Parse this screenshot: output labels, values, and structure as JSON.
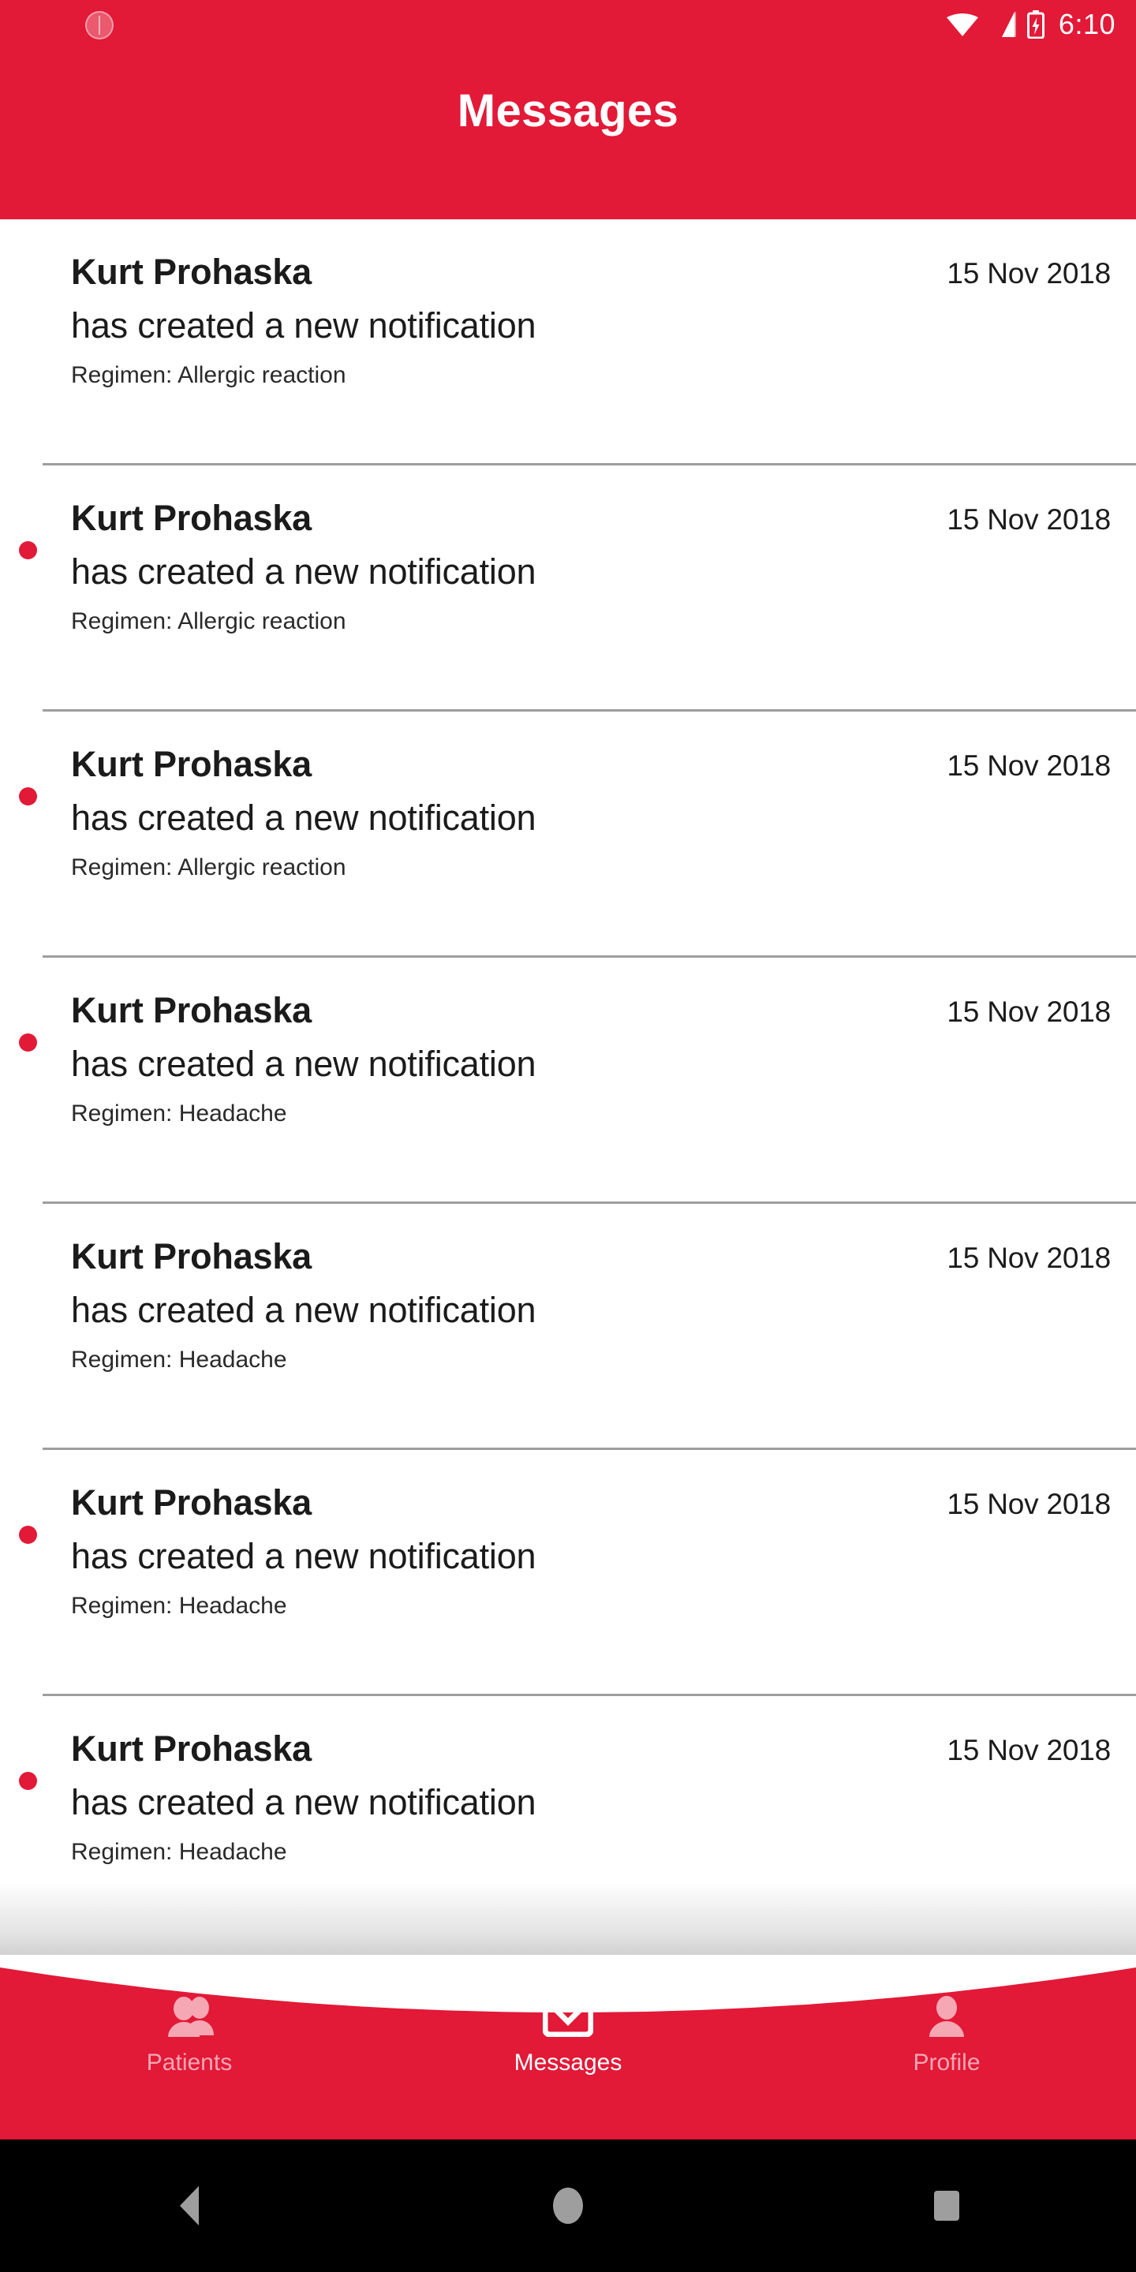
{
  "status_bar": {
    "time": "6:10",
    "left_icon": "sync-circle-icon",
    "right_icons": [
      "wifi-icon",
      "cellular-signal-icon",
      "battery-charging-icon"
    ]
  },
  "header": {
    "title": "Messages",
    "background_color": "#E21937",
    "text_color": "#FFFFFF"
  },
  "colors": {
    "brand_red": "#E21937",
    "unread_dot": "#E21937",
    "divider": "#9E9E9E",
    "nav_inactive": "#F6A7B4",
    "nav_active": "#FFFFFF",
    "body_text": "#1B1B1B",
    "sysnav_icon": "#9E9E9E"
  },
  "messages": [
    {
      "name": "Kurt Prohaska",
      "action": "has created a new notification",
      "regimen": "Regimen: Allergic reaction",
      "date": "15 Nov 2018",
      "unread": false
    },
    {
      "name": "Kurt Prohaska",
      "action": "has created a new notification",
      "regimen": "Regimen: Allergic reaction",
      "date": "15 Nov 2018",
      "unread": true
    },
    {
      "name": "Kurt Prohaska",
      "action": "has created a new notification",
      "regimen": "Regimen: Allergic reaction",
      "date": "15 Nov 2018",
      "unread": true
    },
    {
      "name": "Kurt Prohaska",
      "action": "has created a new notification",
      "regimen": "Regimen: Headache",
      "date": "15 Nov 2018",
      "unread": true
    },
    {
      "name": "Kurt Prohaska",
      "action": "has created a new notification",
      "regimen": "Regimen: Headache",
      "date": "15 Nov 2018",
      "unread": false
    },
    {
      "name": "Kurt Prohaska",
      "action": "has created a new notification",
      "regimen": "Regimen: Headache",
      "date": "15 Nov 2018",
      "unread": true
    },
    {
      "name": "Kurt Prohaska",
      "action": "has created a new notification",
      "regimen": "Regimen: Headache",
      "date": "15 Nov 2018",
      "unread": true
    }
  ],
  "bottom_nav": {
    "items": [
      {
        "label": "Patients",
        "icon": "people-icon",
        "active": false
      },
      {
        "label": "Messages",
        "icon": "envelope-icon",
        "active": true
      },
      {
        "label": "Profile",
        "icon": "person-icon",
        "active": false
      }
    ]
  },
  "system_nav": {
    "back": "back-triangle-icon",
    "home": "home-circle-icon",
    "recents": "recents-square-icon"
  }
}
